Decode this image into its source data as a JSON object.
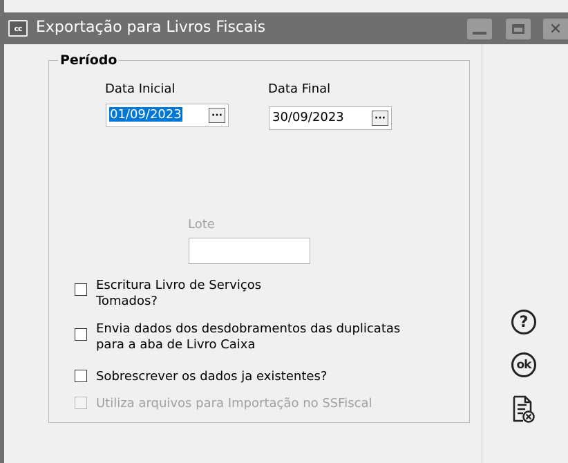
{
  "window": {
    "title": "Exportação para Livros Fiscais",
    "app_icon_text": "cc"
  },
  "periodo": {
    "legend": "Período",
    "data_inicial_label": "Data Inicial",
    "data_inicial_value": "01/09/2023",
    "data_final_label": "Data Final",
    "data_final_value": "30/09/2023",
    "picker_label": "···"
  },
  "lote": {
    "label": "Lote",
    "value": ""
  },
  "options": [
    {
      "label_line1": "Escritura Livro de Serviços",
      "label_line2": "Tomados?",
      "checked": false,
      "enabled": true
    },
    {
      "label_line1": "Envia dados dos desdobramentos das duplicatas",
      "label_line2": "para a aba de Livro Caixa",
      "checked": false,
      "enabled": true
    },
    {
      "label_line1": "Sobrescrever os dados ja existentes?",
      "checked": false,
      "enabled": true
    },
    {
      "label_line1": "Utiliza arquivos para Importação no SSFiscal",
      "checked": false,
      "enabled": false
    }
  ],
  "side_buttons": {
    "help_symbol": "?",
    "ok_symbol": "ok"
  },
  "icons": [
    "window-app-icon",
    "minimize-icon",
    "maximize-icon",
    "close-icon",
    "help-icon",
    "ok-icon",
    "cancel-document-icon"
  ]
}
